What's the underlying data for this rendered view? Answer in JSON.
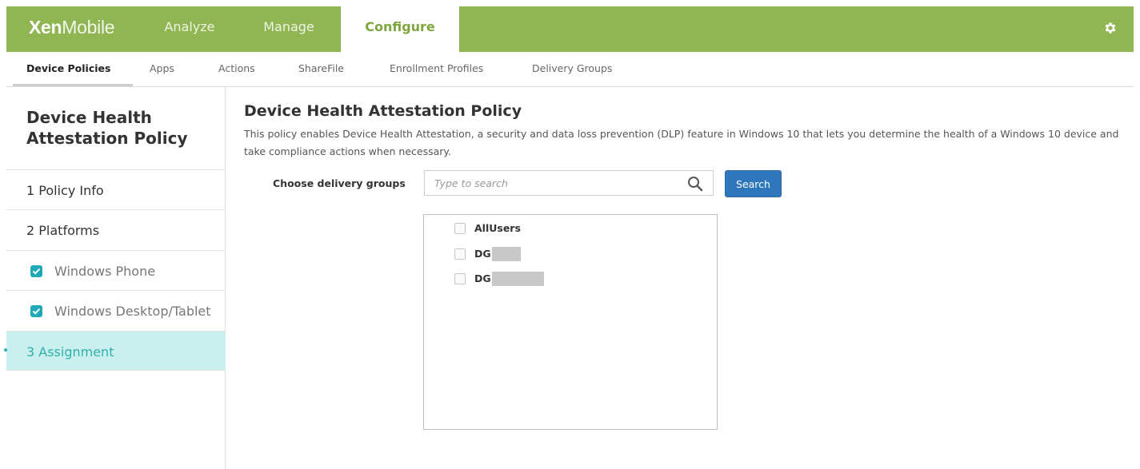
{
  "brand": {
    "bold": "Xen",
    "thin": "Mobile"
  },
  "topnav": [
    {
      "label": "Analyze"
    },
    {
      "label": "Manage"
    },
    {
      "label": "Configure"
    }
  ],
  "subnav": [
    {
      "label": "Device Policies"
    },
    {
      "label": "Apps"
    },
    {
      "label": "Actions"
    },
    {
      "label": "ShareFile"
    },
    {
      "label": "Enrollment Profiles"
    },
    {
      "label": "Delivery Groups"
    }
  ],
  "sidebar": {
    "title_line1": "Device Health",
    "title_line2": "Attestation Policy",
    "items": [
      {
        "label": "1  Policy Info"
      },
      {
        "label": "2  Platforms"
      },
      {
        "label": "Windows Phone",
        "checked": true
      },
      {
        "label": "Windows Desktop/Tablet",
        "checked": true
      },
      {
        "label": "3  Assignment"
      }
    ]
  },
  "main": {
    "title": "Device Health Attestation Policy",
    "description": "This policy enables Device Health Attestation, a security and data loss prevention (DLP) feature in Windows 10 that lets you determine the health of a Windows 10 device and take compliance actions when necessary.",
    "delivery_label": "Choose delivery groups",
    "search_placeholder": "Type to search",
    "search_button": "Search",
    "groups": [
      {
        "label": "AllUsers",
        "checked": false
      },
      {
        "label": "DG",
        "checked": false
      },
      {
        "label": "DG",
        "checked": false
      }
    ]
  },
  "colors": {
    "topbar": "#8fb653",
    "accent_teal": "#2fb0ad",
    "button_blue": "#2f77bd"
  }
}
